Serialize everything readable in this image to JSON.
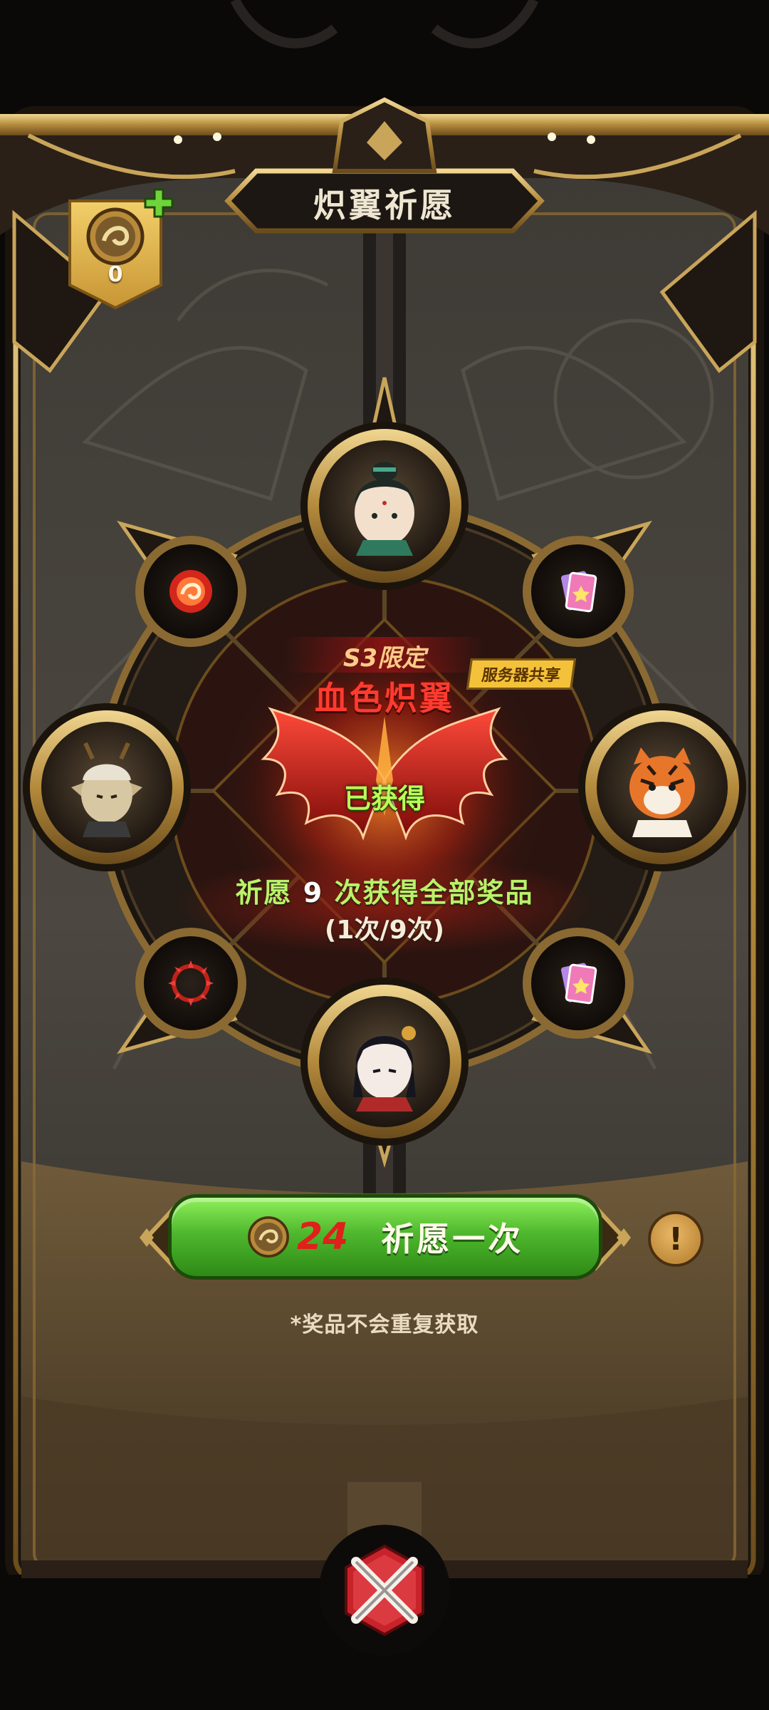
{
  "header": {
    "title": "炽翼祈愿"
  },
  "currency": {
    "count": "0"
  },
  "event": {
    "tag": "S3限定",
    "name": "血色炽翼",
    "server_badge": "服务器共享",
    "status": "已获得"
  },
  "progress": {
    "prefix": "祈愿",
    "count": "9",
    "suffix": "次获得全部奖品",
    "detail": "(1次/9次)"
  },
  "action": {
    "cost": "24",
    "label": "祈愿一次"
  },
  "note": "*奖品不会重复获取",
  "colors": {
    "gold": "#c9a55a",
    "green_button": "#4fb82e",
    "event_red": "#ff3b2e",
    "progress_green": "#b9f26a"
  },
  "icons": {
    "currency": "swirl-coin-icon",
    "plus": "plus-icon",
    "info": "exclamation-icon",
    "close": "crossed-blades-close-icon"
  }
}
